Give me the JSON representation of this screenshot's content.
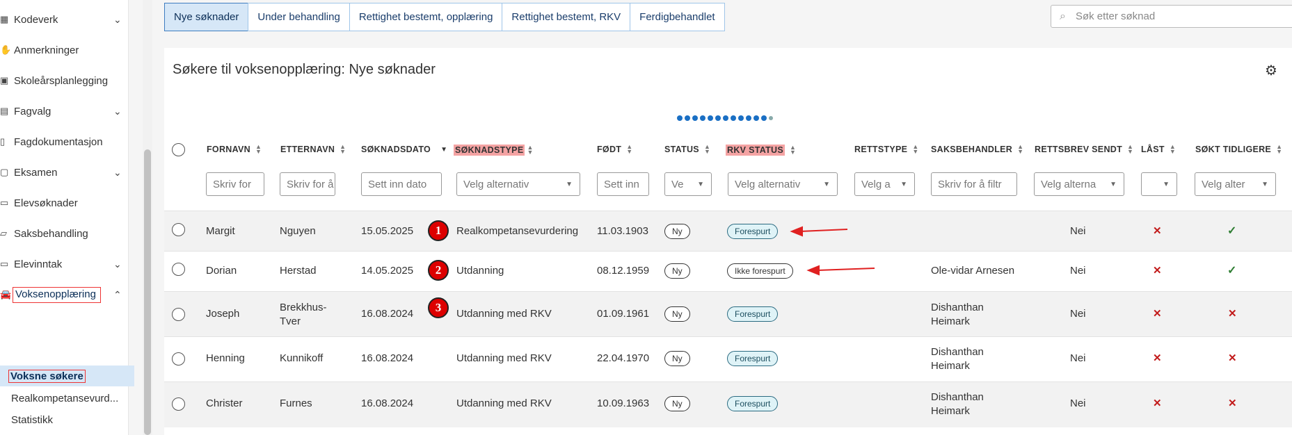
{
  "sidebar": {
    "items": [
      {
        "label": "Kodeverk",
        "icon": "grid-icon",
        "chevron": "⌄"
      },
      {
        "label": "Anmerkninger",
        "icon": "hand-icon",
        "chevron": ""
      },
      {
        "label": "Skoleårsplanlegging",
        "icon": "calendar-icon",
        "chevron": ""
      },
      {
        "label": "Fagvalg",
        "icon": "list-icon",
        "chevron": "⌄"
      },
      {
        "label": "Fagdokumentasjon",
        "icon": "document-icon",
        "chevron": ""
      },
      {
        "label": "Eksamen",
        "icon": "exam-icon",
        "chevron": "⌄"
      },
      {
        "label": "Elevsøknader",
        "icon": "application-icon",
        "chevron": ""
      },
      {
        "label": "Saksbehandling",
        "icon": "folder-icon",
        "chevron": ""
      },
      {
        "label": "Elevinntak",
        "icon": "intake-icon",
        "chevron": "⌄"
      },
      {
        "label": "Voksenopplæring",
        "icon": "car-icon",
        "chevron": "⌃"
      }
    ],
    "subitems": [
      {
        "label": "Voksne søkere"
      },
      {
        "label": "Realkompetansevurd..."
      },
      {
        "label": "Statistikk"
      }
    ]
  },
  "tabs": [
    {
      "label": "Nye søknader"
    },
    {
      "label": "Under behandling"
    },
    {
      "label": "Rettighet bestemt, opplæring"
    },
    {
      "label": "Rettighet bestemt, RKV"
    },
    {
      "label": "Ferdigbehandlet"
    }
  ],
  "search": {
    "placeholder": "Søk etter søknad"
  },
  "panel": {
    "title": "Søkere til voksenopplæring: Nye søknader"
  },
  "columns": [
    {
      "label": "FORNAVN",
      "filter": "Skriv for"
    },
    {
      "label": "ETTERNAVN",
      "filter": "Skriv for å"
    },
    {
      "label": "SØKNADSDATO",
      "filter": "Sett inn dato"
    },
    {
      "label": "SØKNADSTYPE",
      "filter": "Velg alternativ"
    },
    {
      "label": "FØDT",
      "filter": "Sett inn"
    },
    {
      "label": "STATUS",
      "filter": "Ve"
    },
    {
      "label": "RKV STATUS",
      "filter": "Velg alternativ"
    },
    {
      "label": "RETTSTYPE",
      "filter": "Velg a"
    },
    {
      "label": "SAKSBEHANDLER",
      "filter": "Skriv for å filtr"
    },
    {
      "label": "RETTSBREV SENDT",
      "filter": "Velg alterna"
    },
    {
      "label": "LÅST",
      "filter": ""
    },
    {
      "label": "SØKT TIDLIGERE",
      "filter": "Velg alter"
    }
  ],
  "rows": [
    {
      "fornavn": "Margit",
      "etternavn": "Nguyen",
      "dato": "15.05.2025",
      "type": "Realkompetansevurdering",
      "fodt": "11.03.1903",
      "status": "Ny",
      "rkv": "Forespurt",
      "saksbehandler": "",
      "rettsbrev": "Nei",
      "badge": "1"
    },
    {
      "fornavn": "Dorian",
      "etternavn": "Herstad",
      "dato": "14.05.2025",
      "type": "Utdanning",
      "fodt": "08.12.1959",
      "status": "Ny",
      "rkv": "Ikke forespurt",
      "saksbehandler": "Ole-vidar Arnesen",
      "rettsbrev": "Nei",
      "badge": "2"
    },
    {
      "fornavn": "Joseph",
      "etternavn": "Brekkhus-Tver",
      "dato": "16.08.2024",
      "type": "Utdanning med RKV",
      "fodt": "01.09.1961",
      "status": "Ny",
      "rkv": "Forespurt",
      "saksbehandler": "Dishanthan Heimark",
      "rettsbrev": "Nei",
      "badge": "3"
    },
    {
      "fornavn": "Henning",
      "etternavn": "Kunnikoff",
      "dato": "16.08.2024",
      "type": "Utdanning med RKV",
      "fodt": "22.04.1970",
      "status": "Ny",
      "rkv": "Forespurt",
      "saksbehandler": "Dishanthan Heimark",
      "rettsbrev": "Nei",
      "badge": ""
    },
    {
      "fornavn": "Christer",
      "etternavn": "Furnes",
      "dato": "16.08.2024",
      "type": "Utdanning med RKV",
      "fodt": "10.09.1963",
      "status": "Ny",
      "rkv": "Forespurt",
      "saksbehandler": "Dishanthan Heimark",
      "rettsbrev": "Nei",
      "badge": ""
    }
  ],
  "colors": {
    "accent": "#1a6fc4",
    "annotation": "#e02020",
    "x": "#c21a1a",
    "check": "#2e7d32"
  }
}
